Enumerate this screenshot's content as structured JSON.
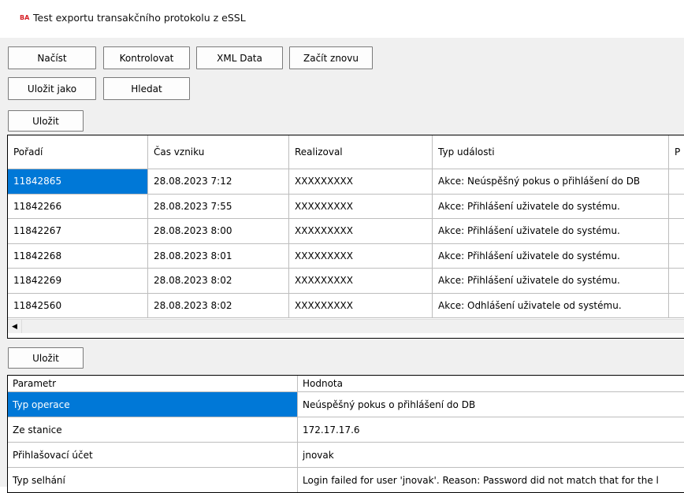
{
  "window": {
    "title": "Test exportu transakčního protokolu z eSSL",
    "icon_text": "BA"
  },
  "toolbar": {
    "load": "Načíst",
    "check": "Kontrolovat",
    "xml_data": "XML Data",
    "restart": "Začít znovu",
    "save_as": "Uložit jako",
    "search": "Hledat"
  },
  "events": {
    "save_label": "Uložit",
    "columns": [
      "Pořadí",
      "Čas vzniku",
      "Realizoval",
      "Typ události",
      "P"
    ],
    "rows": [
      [
        "11842865",
        "28.08.2023 7:12",
        "XXXXXXXXX",
        "Akce: Neúspěšný pokus o přihlášení do DB"
      ],
      [
        "11842266",
        "28.08.2023 7:55",
        "XXXXXXXXX",
        "Akce: Přihlášení uživatele do systému."
      ],
      [
        "11842267",
        "28.08.2023 8:00",
        "XXXXXXXXX",
        "Akce: Přihlášení uživatele do systému."
      ],
      [
        "11842268",
        "28.08.2023 8:01",
        "XXXXXXXXX",
        "Akce: Přihlášení uživatele do systému."
      ],
      [
        "11842269",
        "28.08.2023 8:02",
        "XXXXXXXXX",
        "Akce: Přihlášení uživatele do systému."
      ],
      [
        "11842560",
        "28.08.2023 8:02",
        "XXXXXXXXX",
        "Akce: Odhlášení uživatele od systému."
      ]
    ],
    "selected_row": 0
  },
  "details": {
    "save_label": "Uložit",
    "columns": [
      "Parametr",
      "Hodnota"
    ],
    "rows": [
      [
        "Typ operace",
        "Neúspěšný pokus o přihlášení do DB"
      ],
      [
        "Ze stanice",
        "172.17.17.6"
      ],
      [
        "Přihlašovací účet",
        "jnovak"
      ],
      [
        "Typ selhání",
        "Login failed for user 'jnovak'. Reason: Password did not match that for the l"
      ]
    ],
    "selected_row": 0
  },
  "colors": {
    "selection": "#0078d7",
    "window_bg": "#f0f0f0",
    "grid_line": "#bdbdbd"
  },
  "icons": {
    "scroll_left": "arrow-left-icon"
  }
}
